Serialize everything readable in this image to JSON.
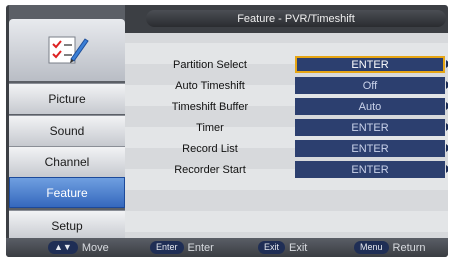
{
  "header": {
    "title": "Feature - PVR/Timeshift"
  },
  "sidebar": {
    "items": [
      {
        "label": "Picture",
        "active": false
      },
      {
        "label": "Sound",
        "active": false
      },
      {
        "label": "Channel",
        "active": false
      },
      {
        "label": "Feature",
        "active": true
      },
      {
        "label": "Setup",
        "active": false
      }
    ]
  },
  "settings": {
    "rows": [
      {
        "label": "Partition Select",
        "value": "ENTER",
        "selected": true
      },
      {
        "label": "Auto Timeshift",
        "value": "Off",
        "selected": false
      },
      {
        "label": "Timeshift Buffer",
        "value": "Auto",
        "selected": false
      },
      {
        "label": "Timer",
        "value": "ENTER",
        "selected": false
      },
      {
        "label": "Record List",
        "value": "ENTER",
        "selected": false
      },
      {
        "label": "Recorder Start",
        "value": "ENTER",
        "selected": false
      }
    ]
  },
  "footer": {
    "move": {
      "key": "▲▼",
      "label": "Move"
    },
    "enter": {
      "key": "Enter",
      "label": "Enter"
    },
    "exit": {
      "key": "Exit",
      "label": "Exit"
    },
    "menu": {
      "key": "Menu",
      "label": "Return"
    }
  },
  "colors": {
    "accent": "#3568bd",
    "selection_border": "#e6a514",
    "value_bg": "#2c3f6f"
  },
  "icons": {
    "logo": "checklist-pencil-icon",
    "row_arrow": "arrow-right-icon"
  }
}
